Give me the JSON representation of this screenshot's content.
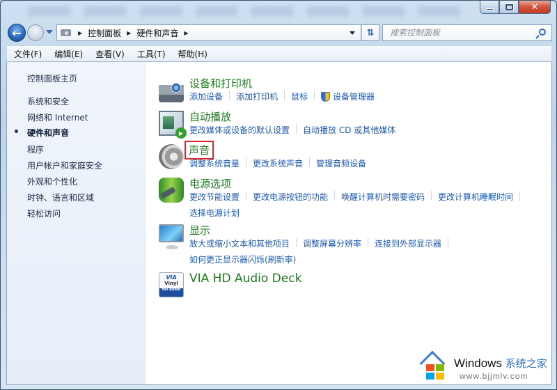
{
  "window": {
    "controls": {
      "minimize": "minimize",
      "maximize": "maximize",
      "close": "✕"
    }
  },
  "nav": {
    "back_icon": "back-arrow-icon",
    "forward_icon": "forward-arrow-icon",
    "breadcrumb": [
      "控制面板",
      "硬件和声音"
    ],
    "search_placeholder": "搜索控制面板"
  },
  "menu": [
    "文件(F)",
    "编辑(E)",
    "查看(V)",
    "工具(T)",
    "帮助(H)"
  ],
  "sidebar": {
    "home": "控制面板主页",
    "items": [
      {
        "label": "系统和安全",
        "current": false
      },
      {
        "label": "网络和 Internet",
        "current": false
      },
      {
        "label": "硬件和声音",
        "current": true
      },
      {
        "label": "程序",
        "current": false
      },
      {
        "label": "用户帐户和家庭安全",
        "current": false
      },
      {
        "label": "外观和个性化",
        "current": false
      },
      {
        "label": "时钟、语言和区域",
        "current": false
      },
      {
        "label": "轻松访问",
        "current": false
      }
    ]
  },
  "categories": [
    {
      "title": "设备和打印机",
      "icon": "printer-camera-icon",
      "links": [
        "添加设备",
        "添加打印机",
        "鼠标",
        "设备管理器"
      ]
    },
    {
      "title": "自动播放",
      "icon": "autoplay-icon",
      "links": [
        "更改媒体或设备的默认设置",
        "自动播放 CD 或其他媒体"
      ]
    },
    {
      "title": "声音",
      "icon": "speaker-icon",
      "highlighted": true,
      "links": [
        "调整系统音量",
        "更改系统声音",
        "管理音频设备"
      ]
    },
    {
      "title": "电源选项",
      "icon": "power-battery-icon",
      "links": [
        "更改节能设置",
        "更改电源按钮的功能",
        "唤醒计算机时需要密码",
        "更改计算机睡眠时间",
        "选择电源计划"
      ]
    },
    {
      "title": "显示",
      "icon": "monitor-icon",
      "links": [
        "放大或缩小文本和其他项目",
        "调整屏幕分辨率",
        "连接到外部显示器",
        "如何更正显示器闪烁(刷新率)"
      ]
    },
    {
      "title": "VIA HD Audio Deck",
      "icon": "via-vinyl-icon",
      "links": []
    }
  ],
  "via_icon": {
    "top": "VIA",
    "mid": "Vinyl",
    "bottom": "HD Audio"
  },
  "watermark": {
    "title": "Windows",
    "title_cn": "系统之家",
    "url": "www.bjjmlv.com"
  },
  "colors": {
    "title_green": "#1f7a1f",
    "link_blue": "#1e59b3",
    "highlight_red": "#e0262a"
  }
}
